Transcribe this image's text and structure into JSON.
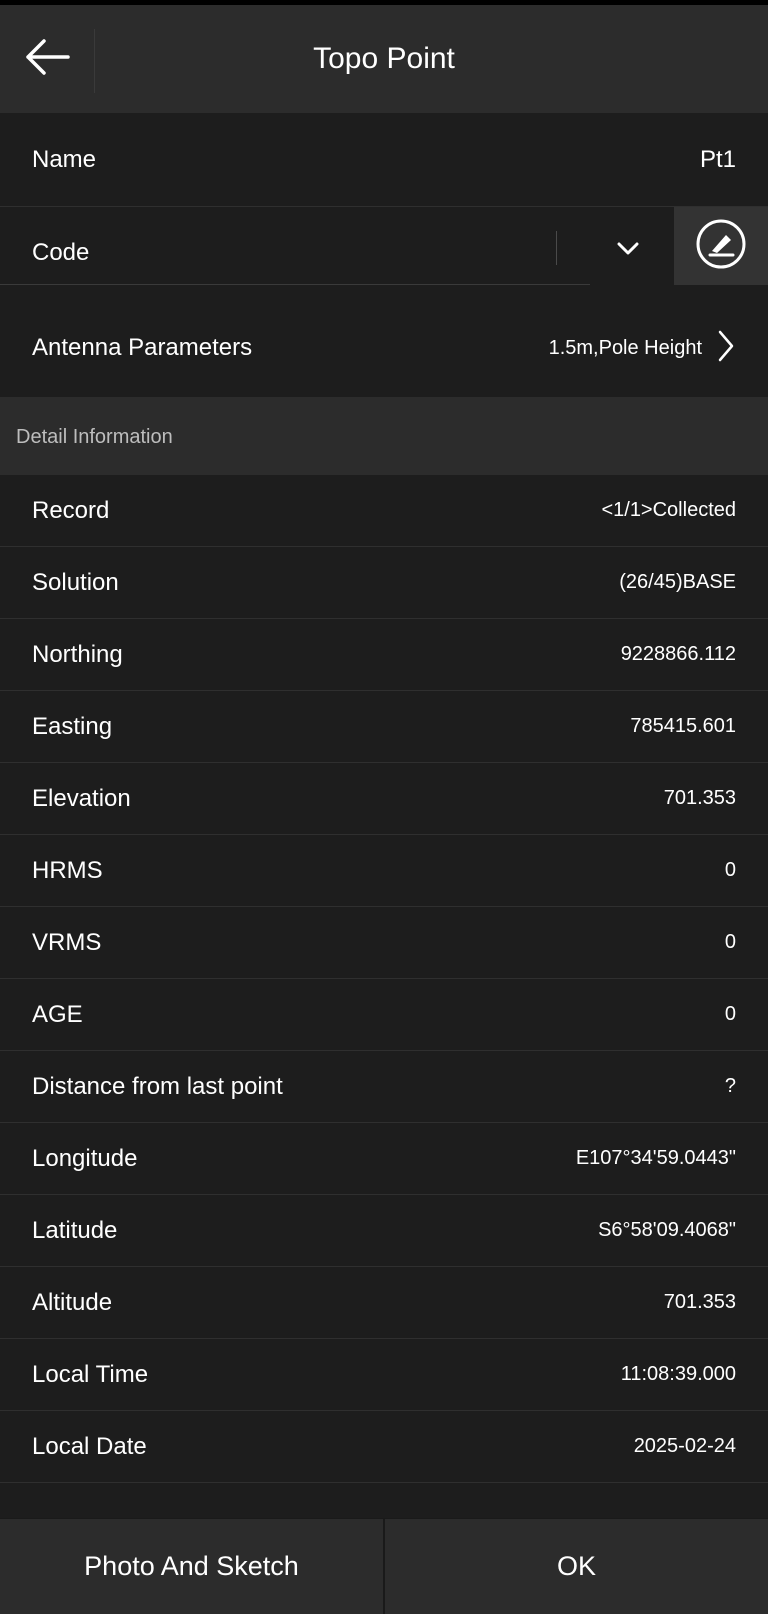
{
  "header": {
    "title": "Topo Point",
    "back_icon": "arrow-left-icon"
  },
  "fields": {
    "name": {
      "label": "Name",
      "value": "Pt1"
    },
    "code": {
      "label": "Code",
      "value": "",
      "dropdown_icon": "chevron-down-icon",
      "edit_icon": "pen-circle-icon"
    },
    "antenna": {
      "label": "Antenna Parameters",
      "value": "1.5m,Pole Height",
      "icon": "chevron-right-icon"
    }
  },
  "section": {
    "title": "Detail Information"
  },
  "details": [
    {
      "label": "Record",
      "value": "<1/1>Collected"
    },
    {
      "label": "Solution",
      "value": "(26/45)BASE"
    },
    {
      "label": "Northing",
      "value": "9228866.112"
    },
    {
      "label": "Easting",
      "value": "785415.601"
    },
    {
      "label": "Elevation",
      "value": "701.353"
    },
    {
      "label": "HRMS",
      "value": "0"
    },
    {
      "label": "VRMS",
      "value": "0"
    },
    {
      "label": "AGE",
      "value": "0"
    },
    {
      "label": "Distance from last point",
      "value": "?"
    },
    {
      "label": "Longitude",
      "value": "E107°34'59.0443\""
    },
    {
      "label": "Latitude",
      "value": "S6°58'09.4068\""
    },
    {
      "label": "Altitude",
      "value": "701.353"
    },
    {
      "label": "Local Time",
      "value": "11:08:39.000"
    },
    {
      "label": "Local Date",
      "value": "2025-02-24"
    }
  ],
  "footer": {
    "photo_label": "Photo And Sketch",
    "ok_label": "OK"
  },
  "colors": {
    "background": "#1d1d1d",
    "header": "#2c2c2c",
    "section": "#2c2c2c",
    "text": "#ffffff",
    "muted": "#bdbdbd"
  }
}
